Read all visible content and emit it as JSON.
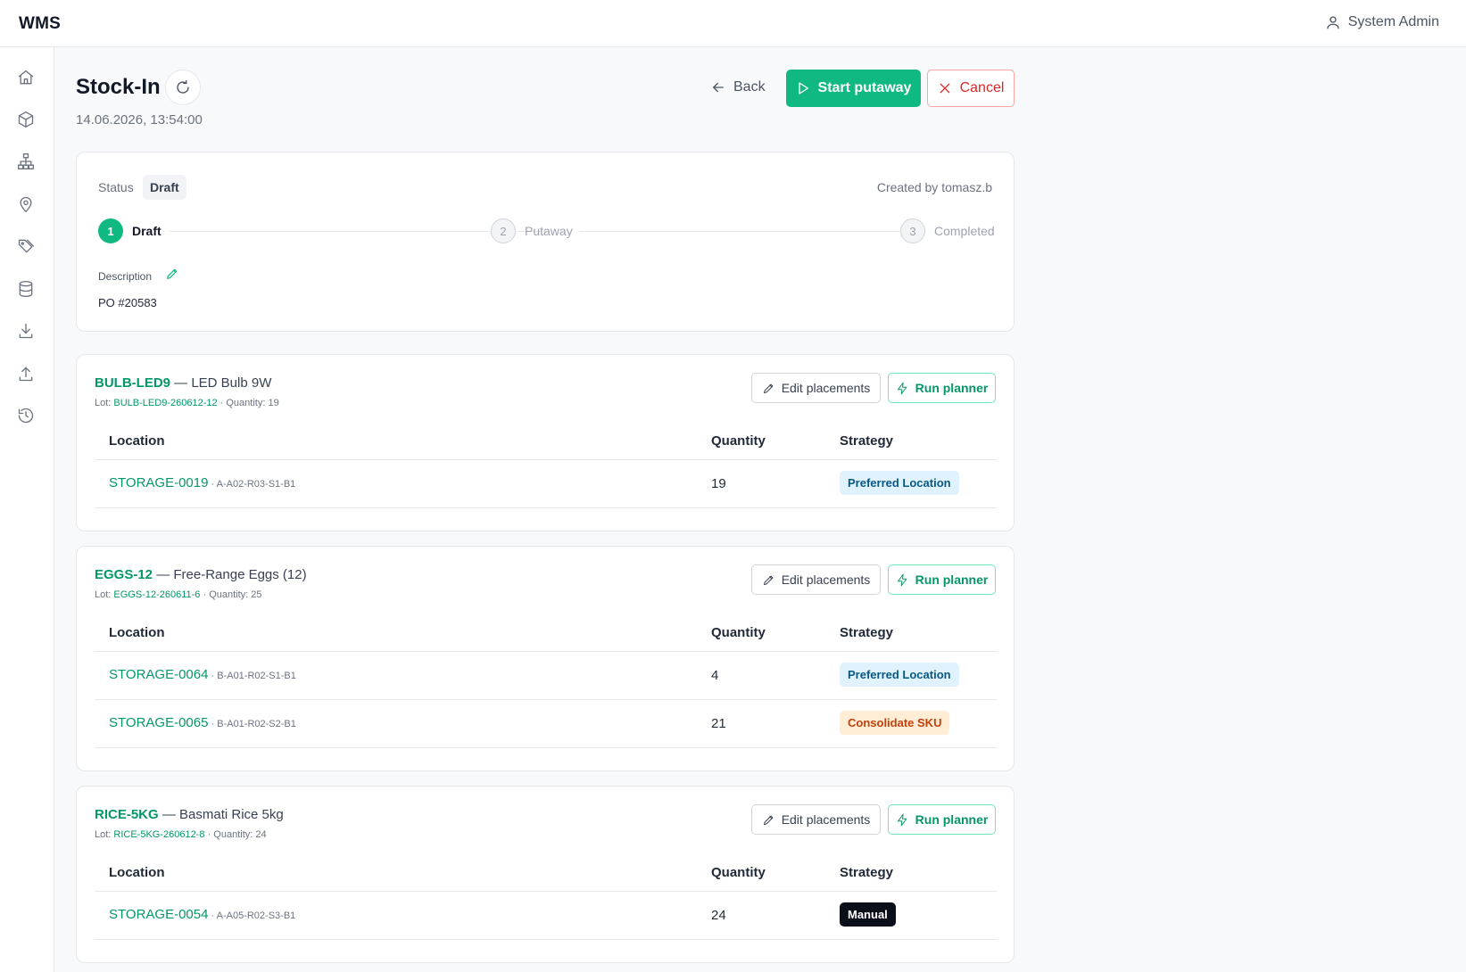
{
  "app": {
    "brand": "WMS",
    "user": "System Admin"
  },
  "sidebar": {
    "items": [
      {
        "icon": "home-icon"
      },
      {
        "icon": "box-icon"
      },
      {
        "icon": "hierarchy-icon"
      },
      {
        "icon": "map-pin-icon"
      },
      {
        "icon": "tags-icon"
      },
      {
        "icon": "database-icon"
      },
      {
        "icon": "download-icon"
      },
      {
        "icon": "upload-icon"
      },
      {
        "icon": "history-icon"
      }
    ]
  },
  "header": {
    "title": "Stock-In",
    "date": "14.06.2026, 13:54:00",
    "back_label": "Back",
    "start_label": "Start putaway",
    "cancel_label": "Cancel"
  },
  "status_card": {
    "status_label": "Status",
    "status_value": "Draft",
    "created_by": "Created by tomasz.b",
    "steps": [
      {
        "num": "1",
        "label": "Draft",
        "active": true
      },
      {
        "num": "2",
        "label": "Putaway",
        "active": false
      },
      {
        "num": "3",
        "label": "Completed",
        "active": false
      }
    ],
    "description_label": "Description",
    "description_value": "PO #20583"
  },
  "items": [
    {
      "sku": "BULB-LED9",
      "name": " — LED Bulb 9W",
      "lot_prefix": "Lot: ",
      "lot": "BULB-LED9-260612-12",
      "qty_text": " · Quantity: 19",
      "edit_label": "Edit placements",
      "run_label": "Run planner",
      "columns": {
        "location": "Location",
        "quantity": "Quantity",
        "strategy": "Strategy"
      },
      "rows": [
        {
          "location": "STORAGE-0019",
          "path": " · A-A02-R03-S1-B1",
          "quantity": "19",
          "strategy": "Preferred Location",
          "strategy_kind": "pref"
        }
      ]
    },
    {
      "sku": "EGGS-12",
      "name": " — Free-Range Eggs (12)",
      "lot_prefix": "Lot: ",
      "lot": "EGGS-12-260611-6",
      "qty_text": " · Quantity: 25",
      "edit_label": "Edit placements",
      "run_label": "Run planner",
      "columns": {
        "location": "Location",
        "quantity": "Quantity",
        "strategy": "Strategy"
      },
      "rows": [
        {
          "location": "STORAGE-0064",
          "path": " · B-A01-R02-S1-B1",
          "quantity": "4",
          "strategy": "Preferred Location",
          "strategy_kind": "pref"
        },
        {
          "location": "STORAGE-0065",
          "path": " · B-A01-R02-S2-B1",
          "quantity": "21",
          "strategy": "Consolidate SKU",
          "strategy_kind": "cons"
        }
      ]
    },
    {
      "sku": "RICE-5KG",
      "name": " — Basmati Rice 5kg",
      "lot_prefix": "Lot: ",
      "lot": "RICE-5KG-260612-8",
      "qty_text": " · Quantity: 24",
      "edit_label": "Edit placements",
      "run_label": "Run planner",
      "columns": {
        "location": "Location",
        "quantity": "Quantity",
        "strategy": "Strategy"
      },
      "rows": [
        {
          "location": "STORAGE-0054",
          "path": " · A-A05-R02-S3-B1",
          "quantity": "24",
          "strategy": "Manual",
          "strategy_kind": "man"
        }
      ]
    }
  ],
  "colors": {
    "accent": "#10b981",
    "danger": "#dc2626"
  }
}
